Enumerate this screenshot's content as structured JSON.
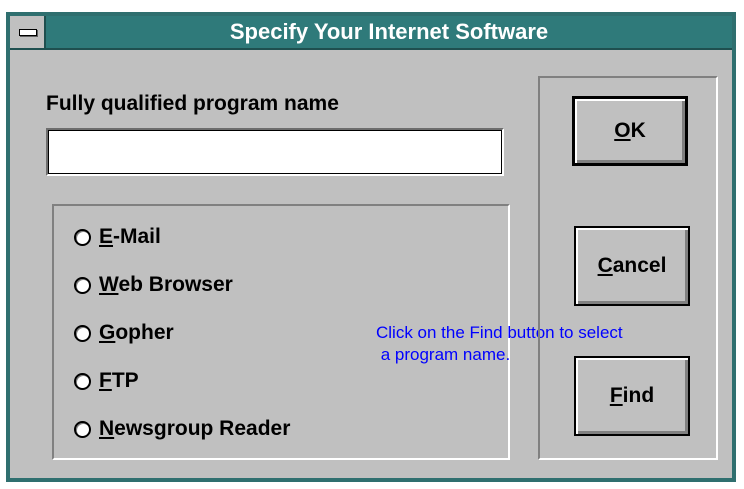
{
  "window": {
    "title": "Specify Your Internet Software"
  },
  "program": {
    "label": "Fully qualified program name",
    "value": ""
  },
  "radios": [
    {
      "key": "E",
      "rest": "-Mail",
      "selected": false
    },
    {
      "key": "W",
      "rest": "eb Browser",
      "selected": false
    },
    {
      "key": "G",
      "rest": "opher",
      "selected": false
    },
    {
      "key": "F",
      "rest": "TP",
      "selected": false
    },
    {
      "key": "N",
      "rest": "ewsgroup Reader",
      "selected": false
    }
  ],
  "hint": {
    "line1": "Click on the Find button to select",
    "line2": " a program name."
  },
  "buttons": {
    "ok": {
      "key": "O",
      "rest": "K"
    },
    "cancel": {
      "key": "C",
      "rest": "ancel"
    },
    "find": {
      "key": "F",
      "rest": "ind"
    }
  },
  "colors": {
    "titlebar": "#2f7a7a",
    "face": "#c0c0c0",
    "hint_text": "#0000ff"
  },
  "icons": {
    "system_menu": "system-menu-icon"
  }
}
